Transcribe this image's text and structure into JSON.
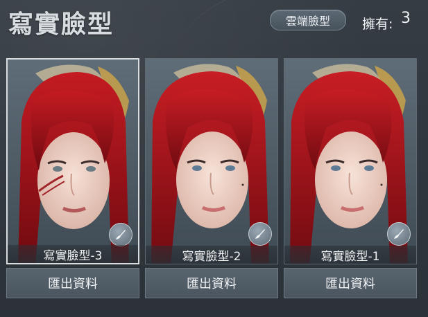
{
  "header": {
    "title": "寫實臉型",
    "cloud_button": "雲端臉型",
    "own_label": "擁有:",
    "own_count": "3"
  },
  "cards": [
    {
      "label": "寫實臉型-3",
      "export": "匯出資料",
      "selected": true,
      "has_scar": true
    },
    {
      "label": "寫實臉型-2",
      "export": "匯出資料",
      "selected": false,
      "has_scar": false
    },
    {
      "label": "寫實臉型-1",
      "export": "匯出資料",
      "selected": false,
      "has_scar": false
    }
  ],
  "colors": {
    "background": "#2f363d",
    "hair": "#a3121a",
    "skin": "#efd3c8",
    "ornament": "#c9a24a"
  },
  "icons": {
    "card_badge": "brush-icon"
  }
}
